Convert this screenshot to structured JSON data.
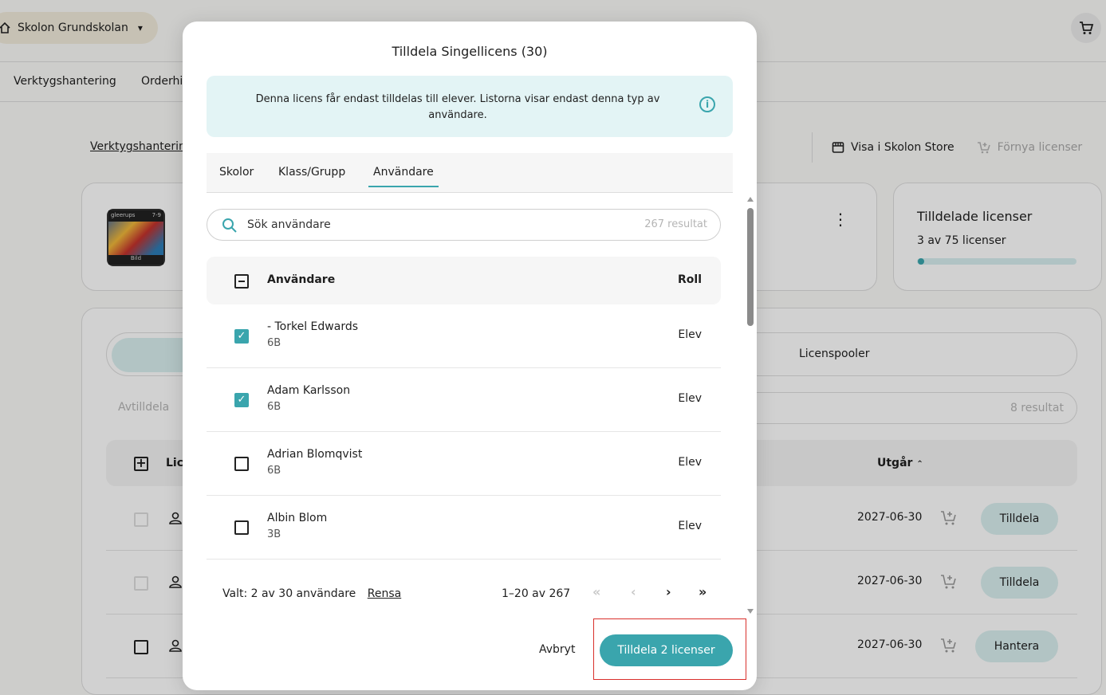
{
  "header": {
    "school": "Skolon Grundskolan"
  },
  "nav": {
    "item1": "Verktygshantering",
    "item2": "Orderhi"
  },
  "breadcrumb": "Verktygshanterin",
  "top_actions": {
    "view_store": "Visa i Skolon Store",
    "renew": "Förnya licenser"
  },
  "product": {
    "publisher": "gleerups",
    "grade": "7-9",
    "subject": "Bild"
  },
  "license_card": {
    "title": "Tilldelade licenser",
    "count": "3 av 75 licenser",
    "progress": 0.04
  },
  "bg_tabs": {
    "pool": "Licenspooler"
  },
  "bg_actions": {
    "unassign": "Avtilldela",
    "results": "8 resultat"
  },
  "bg_table": {
    "col_license": "Lic",
    "col_expires": "Utgår",
    "rows": [
      {
        "date": "2027-06-30",
        "action": "Tilldela"
      },
      {
        "date": "2027-06-30",
        "action": "Tilldela"
      },
      {
        "date": "2027-06-30",
        "action": "Hantera"
      }
    ]
  },
  "modal": {
    "title": "Tilldela Singellicens (30)",
    "info": "Denna licens får endast tilldelas till elever. Listorna visar endast denna typ av användare.",
    "tabs": [
      "Skolor",
      "Klass/Grupp",
      "Användare"
    ],
    "search_placeholder": "Sök användare",
    "result_count": "267 resultat",
    "col_user": "Användare",
    "col_role": "Roll",
    "users": [
      {
        "name": "- Torkel Edwards",
        "class": "6B",
        "role": "Elev",
        "checked": true
      },
      {
        "name": "Adam Karlsson",
        "class": "6B",
        "role": "Elev",
        "checked": true
      },
      {
        "name": "Adrian Blomqvist",
        "class": "6B",
        "role": "Elev",
        "checked": false
      },
      {
        "name": "Albin Blom",
        "class": "3B",
        "role": "Elev",
        "checked": false
      }
    ],
    "selected": "Valt: 2 av 30 användare",
    "clear": "Rensa",
    "paging": "1–20 av 267",
    "cancel": "Avbryt",
    "confirm": "Tilldela 2 licenser"
  }
}
